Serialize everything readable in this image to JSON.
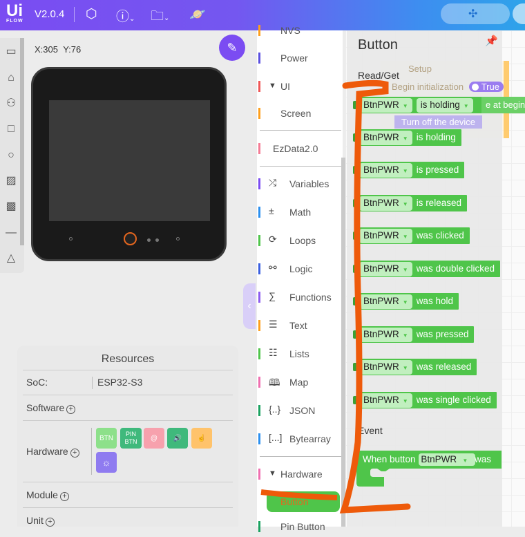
{
  "header": {
    "logo": "Ui",
    "logo_sub": "FLOW",
    "version": "V2.0.4",
    "icons": [
      "settings-hex-icon",
      "help-icon",
      "folder-icon",
      "planet-icon",
      "puzzle-icon"
    ]
  },
  "tools": [
    "window-icon",
    "tag-icon",
    "user-pin-icon",
    "square-icon",
    "circle-icon",
    "image-icon",
    "image-cloud-icon",
    "line-icon",
    "triangle-icon"
  ],
  "canvas": {
    "x_label": "X:305",
    "y_label": "Y:76"
  },
  "resources": {
    "title": "Resources",
    "soc_label": "SoC:",
    "soc_value": "ESP32-S3",
    "software": "Software",
    "hardware": "Hardware",
    "module": "Module",
    "unit": "Unit",
    "hw_items": [
      {
        "label": "BTN",
        "color": "#8de08a"
      },
      {
        "label": "PIN BTN",
        "color": "#3fb97c"
      },
      {
        "label": "@",
        "color": "#f7a1ad"
      },
      {
        "label": "🔊",
        "color": "#3fb97c"
      },
      {
        "label": "☝",
        "color": "#ffc36b"
      },
      {
        "label": "☼",
        "color": "#8f7bf0"
      }
    ]
  },
  "categories": [
    {
      "label": "NVS",
      "color": "#ff9f1c"
    },
    {
      "label": "Power",
      "color": "#5a4fe0"
    },
    {
      "label": "UI",
      "color": "#f05656"
    },
    {
      "label": "Screen",
      "color": "#ff9f1c"
    },
    {
      "label": "EzData2.0",
      "color": "#f57c95"
    },
    {
      "label": "Variables",
      "color": "#7b4cf2"
    },
    {
      "label": "Math",
      "color": "#2a8ff0"
    },
    {
      "label": "Loops",
      "color": "#4fc54a"
    },
    {
      "label": "Logic",
      "color": "#3a5fe0"
    },
    {
      "label": "Functions",
      "color": "#8d5cf0"
    },
    {
      "label": "Text",
      "color": "#ff9f1c"
    },
    {
      "label": "Lists",
      "color": "#4fc54a"
    },
    {
      "label": "Map",
      "color": "#f06fb0"
    },
    {
      "label": "JSON",
      "color": "#1aa260"
    },
    {
      "label": "Bytearray",
      "color": "#2a8ff0"
    },
    {
      "label": "Hardware",
      "color": "#f06fb0"
    },
    {
      "label": "Button",
      "color": "#4fc54a"
    },
    {
      "label": "Pin Button",
      "color": "#1aa260"
    }
  ],
  "flyout": {
    "title": "Button",
    "read_get": "Read/Get",
    "event": "Event",
    "device": "BtnPWR",
    "blocks": [
      "is holding",
      "is holding",
      "is pressed",
      "is released",
      "was clicked",
      "was double clicked",
      "was hold",
      "was pressed",
      "was released",
      "was single clicked"
    ],
    "event_block": {
      "prefix": "When button",
      "suffix": "was"
    }
  },
  "ghost": {
    "setup": "Setup",
    "init": "Begin initialization",
    "toggle": "True",
    "at_begin": "e at beginn",
    "turn_off": "Turn off the device"
  },
  "colors": {
    "accent": "#7b4cf2",
    "block": "#4fc54a",
    "annotation": "#ee5a0a"
  }
}
